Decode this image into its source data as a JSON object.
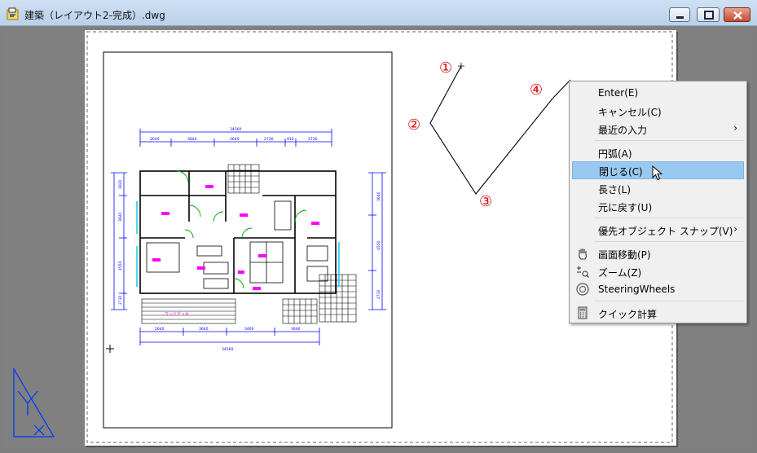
{
  "window": {
    "title": "建築（レイアウト2-完成）.dwg"
  },
  "drawing": {
    "point_labels": [
      "①",
      "②",
      "③",
      "④"
    ],
    "dims_top_total": "34560",
    "dims_top": [
      "2640",
      "3640",
      "3640",
      "2730",
      "910",
      "2730"
    ],
    "dims_bottom_total": "34560",
    "dims_bottom": [
      "2640",
      "3640",
      "3460",
      "3646"
    ],
    "dims_left": [
      "1820",
      "3640",
      "4550",
      "2730"
    ],
    "dims_right": [
      "3640",
      "4550",
      "2730"
    ],
    "room_label": "ウッドデッキ"
  },
  "context_menu": {
    "items": [
      {
        "label": "Enter(E)",
        "icon": "",
        "submenu": false
      },
      {
        "label": "キャンセル(C)",
        "icon": "",
        "submenu": false
      },
      {
        "label": "最近の入力",
        "icon": "",
        "submenu": true,
        "arrow": "›"
      },
      {
        "label": "円弧(A)",
        "icon": "",
        "submenu": false
      },
      {
        "label": "閉じる(C)",
        "icon": "",
        "submenu": false,
        "highlighted": true
      },
      {
        "label": "長さ(L)",
        "icon": "",
        "submenu": false
      },
      {
        "label": "元に戻す(U)",
        "icon": "",
        "submenu": false
      },
      {
        "label": "優先オブジェクト スナップ(V)",
        "icon": "",
        "submenu": true,
        "arrow": "›"
      },
      {
        "label": "画面移動(P)",
        "icon": "pan-hand-icon",
        "submenu": false
      },
      {
        "label": "ズーム(Z)",
        "icon": "zoom-icon",
        "submenu": false
      },
      {
        "label": "SteeringWheels",
        "icon": "steering-wheel-icon",
        "submenu": false
      },
      {
        "label": "クイック計算",
        "icon": "calculator-icon",
        "submenu": false
      }
    ]
  },
  "colors": {
    "cad_blue": "#0000ff",
    "cad_magenta": "#ff00ff",
    "cad_green": "#00a000",
    "cad_cyan": "#00c0ff",
    "point_red": "#e00000",
    "menu_highlight": "#99c9ef"
  }
}
